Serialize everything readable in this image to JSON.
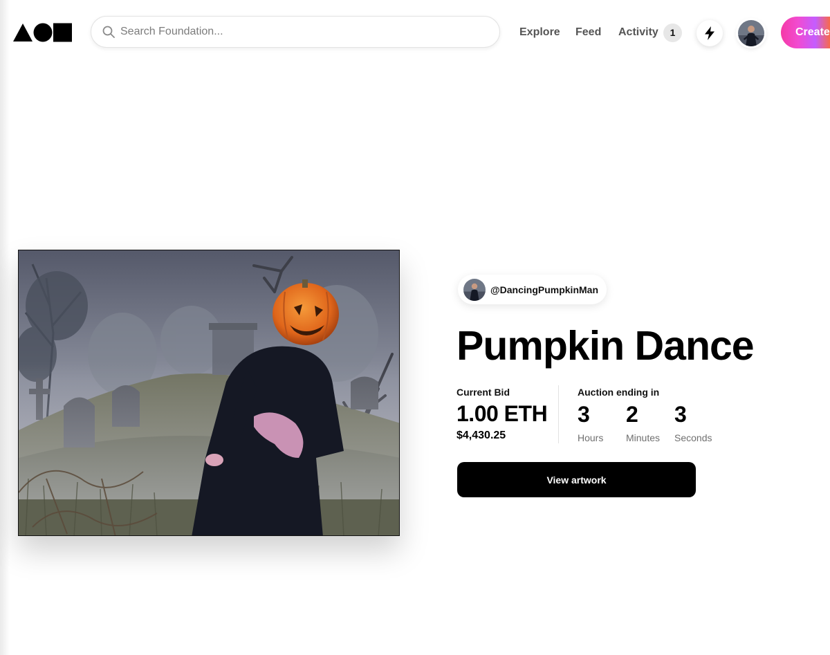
{
  "header": {
    "search": {
      "placeholder": "Search Foundation..."
    },
    "nav": {
      "explore": "Explore",
      "feed": "Feed",
      "activity": "Activity",
      "activity_count": "1"
    },
    "create_label": "Create"
  },
  "auction": {
    "creator_handle": "@DancingPumpkinMan",
    "title": "Pumpkin Dance",
    "current_bid_label": "Current Bid",
    "current_bid_value": "1.00 ETH",
    "current_bid_usd": "$4,430.25",
    "ending_label": "Auction ending in",
    "countdown": [
      {
        "value": "3",
        "unit": "Hours"
      },
      {
        "value": "2",
        "unit": "Minutes"
      },
      {
        "value": "3",
        "unit": "Seconds"
      }
    ],
    "view_button": "View artwork"
  },
  "icons": {
    "logo": "foundation-logo-icon",
    "search": "search-icon",
    "bolt": "lightning-bolt-icon"
  },
  "colors": {
    "create_gradient_start": "#f53aa6",
    "create_gradient_end": "#c45dff",
    "button_dark": "#000000"
  }
}
